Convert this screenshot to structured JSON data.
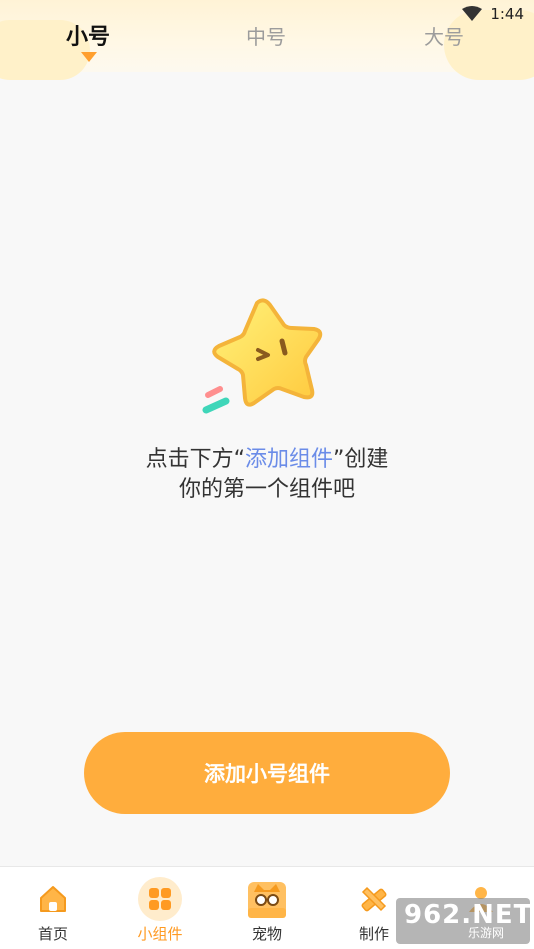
{
  "status": {
    "time": "1:44",
    "wifi_icon": "wifi-icon"
  },
  "tabs": [
    {
      "label": "小号",
      "active": true
    },
    {
      "label": "中号",
      "active": false
    },
    {
      "label": "大号",
      "active": false
    }
  ],
  "empty_state": {
    "line1_prefix": "点击下方“",
    "line1_highlight": "添加组件",
    "line1_suffix": "”创建",
    "line2": "你的第一个组件吧",
    "illustration": "star-mascot-icon"
  },
  "add_button": {
    "label": "添加小号组件"
  },
  "nav": [
    {
      "label": "首页",
      "icon": "home-icon",
      "active": false
    },
    {
      "label": "小组件",
      "icon": "widgets-icon",
      "active": true
    },
    {
      "label": "宠物",
      "icon": "pet-icon",
      "active": false
    },
    {
      "label": "制作",
      "icon": "ruler-pencil-icon",
      "active": false
    },
    {
      "label": "",
      "icon": "profile-icon",
      "active": false
    }
  ],
  "watermark": {
    "brand": "962.NET",
    "sub": "乐游网"
  },
  "colors": {
    "accent": "#ffad3d",
    "highlight": "#6b8ce8",
    "nav_active": "#ff9a22"
  }
}
